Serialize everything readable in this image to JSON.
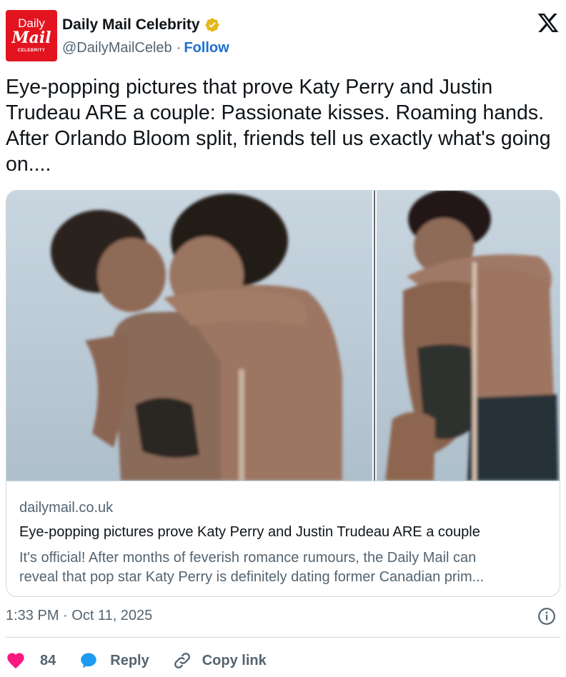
{
  "account": {
    "avatar_line1": "Daily",
    "avatar_line2": "Mail",
    "avatar_line3": "CELEBRITY",
    "display_name": "Daily Mail Celebrity",
    "handle": "@DailyMailCeleb",
    "separator": "·",
    "follow_label": "Follow",
    "verified_icon": "verified-badge-icon",
    "brand_color": "#e3141f",
    "verified_color": "#e2b719"
  },
  "platform_logo": "x-logo-icon",
  "tweet": {
    "text": "Eye-popping pictures that prove Katy Perry and Justin Trudeau ARE a couple: Passionate kisses. Roaming hands. After Orlando Bloom split, friends tell us exactly what's going on...."
  },
  "link_card": {
    "domain": "dailymail.co.uk",
    "title": "Eye-popping pictures prove Katy Perry and Justin Trudeau ARE a couple",
    "description_line1": "It's official! After months of feverish romance rumours, the Daily Mail can",
    "description_line2": "reveal that pop star Katy Perry is definitely dating former Canadian prim..."
  },
  "meta": {
    "timestamp": "1:33 PM · Oct 11, 2025",
    "info_icon": "info-icon"
  },
  "actions": {
    "like_count": "84",
    "reply_label": "Reply",
    "copy_label": "Copy link",
    "like_color": "#f91880",
    "reply_color": "#1d9bf0"
  }
}
